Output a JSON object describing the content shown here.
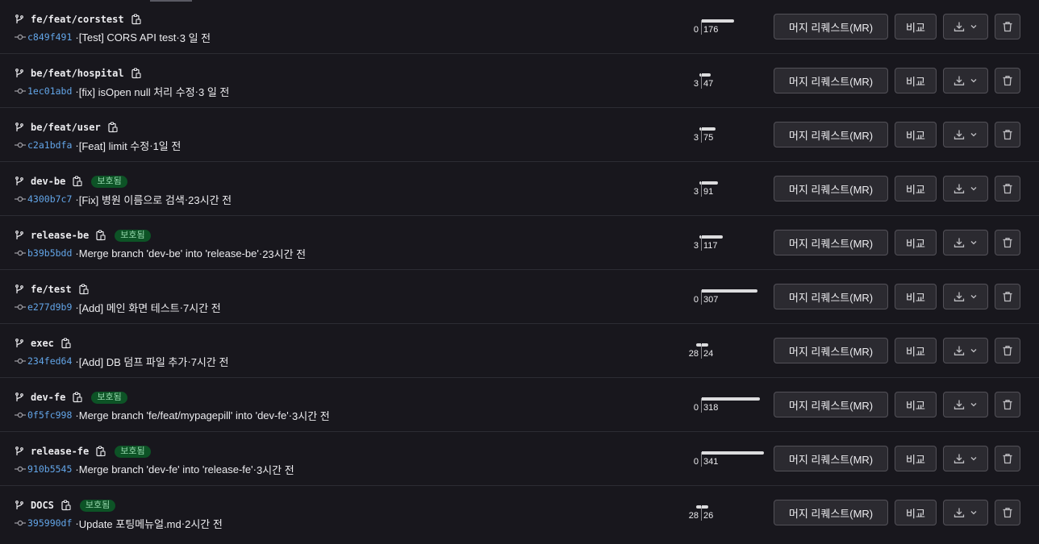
{
  "actions": {
    "merge_request_label": "머지 리퀘스트(MR)",
    "compare_label": "비교"
  },
  "branches": [
    {
      "name": "fe/feat/corstest",
      "protected": false,
      "sha": "c849f491",
      "message": "[Test] CORS API test",
      "time": "3 일 전",
      "behind": 0,
      "ahead": 176
    },
    {
      "name": "be/feat/hospital",
      "protected": false,
      "sha": "1ec01abd",
      "message": "[fix] isOpen null 처리 수정",
      "time": "3 일 전",
      "behind": 3,
      "ahead": 47
    },
    {
      "name": "be/feat/user",
      "protected": false,
      "sha": "c2a1bdfa",
      "message": "[Feat] limit 수정",
      "time": "1일 전",
      "behind": 3,
      "ahead": 75
    },
    {
      "name": "dev-be",
      "protected": true,
      "badge": "보호됨",
      "sha": "4300b7c7",
      "message": "[Fix] 병원 이름으로 검색",
      "time": "23시간 전",
      "behind": 3,
      "ahead": 91
    },
    {
      "name": "release-be",
      "protected": true,
      "badge": "보호됨",
      "sha": "b39b5bdd",
      "message": "Merge branch 'dev-be' into 'release-be'",
      "time": "23시간 전",
      "behind": 3,
      "ahead": 117
    },
    {
      "name": "fe/test",
      "protected": false,
      "sha": "e277d9b9",
      "message": "[Add] 메인 화면 테스트",
      "time": "7시간 전",
      "behind": 0,
      "ahead": 307
    },
    {
      "name": "exec",
      "protected": false,
      "sha": "234fed64",
      "message": "[Add] DB 덤프 파일 추가",
      "time": "7시간 전",
      "behind": 28,
      "ahead": 24
    },
    {
      "name": "dev-fe",
      "protected": true,
      "badge": "보호됨",
      "sha": "0f5fc998",
      "message": "Merge branch 'fe/feat/mypagepill' into 'dev-fe'",
      "time": "3시간 전",
      "behind": 0,
      "ahead": 318
    },
    {
      "name": "release-fe",
      "protected": true,
      "badge": "보호됨",
      "sha": "910b5545",
      "message": "Merge branch 'dev-fe' into 'release-fe'",
      "time": "3시간 전",
      "behind": 0,
      "ahead": 341
    },
    {
      "name": "DOCS",
      "protected": true,
      "badge": "보호됨",
      "sha": "395990df",
      "message": "Update 포팅메뉴얼.md",
      "time": "2시간 전",
      "behind": 28,
      "ahead": 26
    }
  ]
}
